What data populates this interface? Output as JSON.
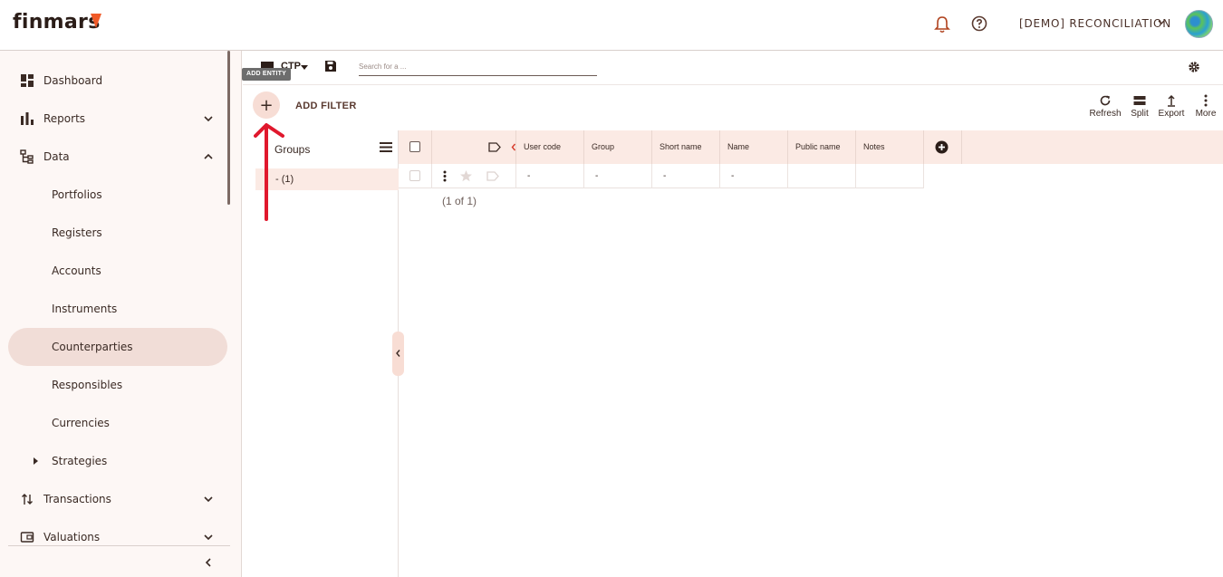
{
  "header": {
    "logo": "finmars",
    "workspace": "[DEMO] RECONCILIATION"
  },
  "sidebar": {
    "items": [
      {
        "label": "Dashboard"
      },
      {
        "label": "Reports"
      },
      {
        "label": "Data"
      }
    ],
    "sub_items": [
      {
        "label": "Portfolios"
      },
      {
        "label": "Registers"
      },
      {
        "label": "Accounts"
      },
      {
        "label": "Instruments"
      },
      {
        "label": "Counterparties"
      },
      {
        "label": "Responsibles"
      },
      {
        "label": "Currencies"
      },
      {
        "label": "Strategies"
      }
    ],
    "bottom_items": [
      {
        "label": "Transactions"
      },
      {
        "label": "Valuations"
      }
    ]
  },
  "toolbar": {
    "layout_label": "CTP",
    "search_placeholder": "Search for a ...",
    "tooltip": "ADD ENTITY",
    "add_entity": "+",
    "add_filter": "ADD FILTER",
    "actions": [
      {
        "label": "Refresh"
      },
      {
        "label": "Split"
      },
      {
        "label": "Export"
      },
      {
        "label": "More"
      }
    ]
  },
  "groups": {
    "title": "Groups",
    "row": "- (1)"
  },
  "table": {
    "columns": [
      "User code",
      "Group",
      "Short name",
      "Name",
      "Public name",
      "Notes"
    ],
    "row": [
      "-",
      "-",
      "-",
      "-",
      "",
      ""
    ],
    "pager": "(1 of 1)"
  },
  "colors": {
    "accent": "#f05a28",
    "active_bg": "#f1ddd7",
    "header_bg": "#fbeae4",
    "annotation": "#e0182d"
  }
}
